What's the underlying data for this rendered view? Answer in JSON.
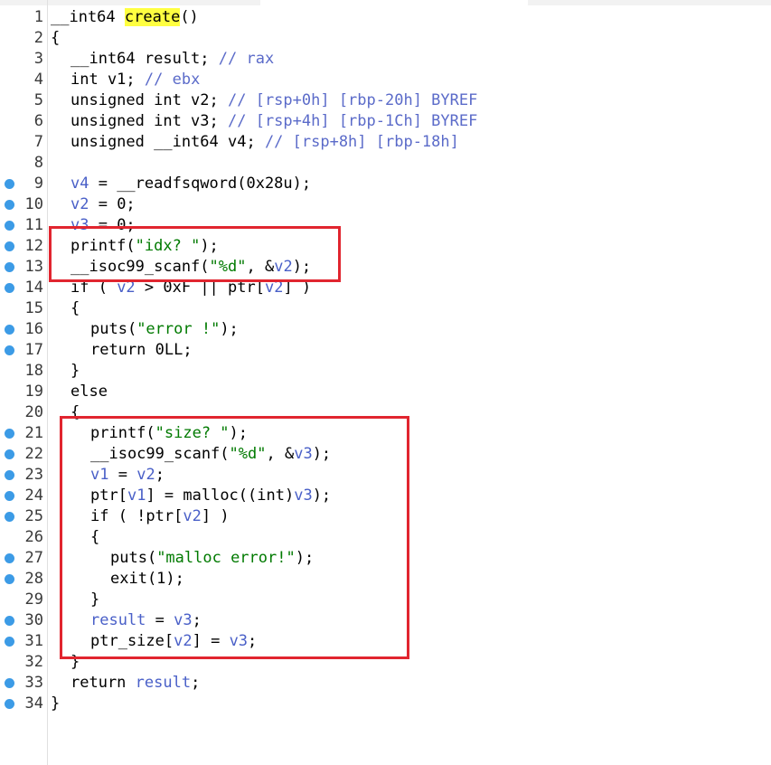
{
  "editor": {
    "lines": [
      {
        "no": "1",
        "bp": false,
        "indent": 0,
        "tokens": [
          [
            "t",
            "__int64 "
          ],
          [
            "h",
            "create"
          ],
          [
            "t",
            "()"
          ]
        ]
      },
      {
        "no": "2",
        "bp": false,
        "indent": 0,
        "tokens": [
          [
            "t",
            "{"
          ]
        ]
      },
      {
        "no": "3",
        "bp": false,
        "indent": 1,
        "tokens": [
          [
            "t",
            "__int64 result; "
          ],
          [
            "c",
            "// rax"
          ]
        ]
      },
      {
        "no": "4",
        "bp": false,
        "indent": 1,
        "tokens": [
          [
            "t",
            "int v1; "
          ],
          [
            "c",
            "// ebx"
          ]
        ]
      },
      {
        "no": "5",
        "bp": false,
        "indent": 1,
        "tokens": [
          [
            "t",
            "unsigned int v2; "
          ],
          [
            "c",
            "// [rsp+0h] [rbp-20h] BYREF"
          ]
        ]
      },
      {
        "no": "6",
        "bp": false,
        "indent": 1,
        "tokens": [
          [
            "t",
            "unsigned int v3; "
          ],
          [
            "c",
            "// [rsp+4h] [rbp-1Ch] BYREF"
          ]
        ]
      },
      {
        "no": "7",
        "bp": false,
        "indent": 1,
        "tokens": [
          [
            "t",
            "unsigned __int64 v4; "
          ],
          [
            "c",
            "// [rsp+8h] [rbp-18h]"
          ]
        ]
      },
      {
        "no": "8",
        "bp": false,
        "indent": 0,
        "tokens": []
      },
      {
        "no": "9",
        "bp": true,
        "indent": 1,
        "tokens": [
          [
            "v",
            "v4"
          ],
          [
            "t",
            " = __readfsqword(0x28u);"
          ]
        ]
      },
      {
        "no": "10",
        "bp": true,
        "indent": 1,
        "tokens": [
          [
            "v",
            "v2"
          ],
          [
            "t",
            " = 0;"
          ]
        ]
      },
      {
        "no": "11",
        "bp": true,
        "indent": 1,
        "tokens": [
          [
            "v",
            "v3"
          ],
          [
            "t",
            " = 0;"
          ]
        ]
      },
      {
        "no": "12",
        "bp": true,
        "indent": 1,
        "tokens": [
          [
            "t",
            "printf("
          ],
          [
            "s",
            "\"idx? \""
          ],
          [
            "t",
            ");"
          ]
        ]
      },
      {
        "no": "13",
        "bp": true,
        "indent": 1,
        "tokens": [
          [
            "t",
            "__isoc99_scanf("
          ],
          [
            "s",
            "\"%d\""
          ],
          [
            "t",
            ", &"
          ],
          [
            "v",
            "v2"
          ],
          [
            "t",
            ");"
          ]
        ]
      },
      {
        "no": "14",
        "bp": true,
        "indent": 1,
        "tokens": [
          [
            "t",
            "if ( "
          ],
          [
            "v",
            "v2"
          ],
          [
            "t",
            " > 0xF || ptr["
          ],
          [
            "v",
            "v2"
          ],
          [
            "t",
            "] )"
          ]
        ]
      },
      {
        "no": "15",
        "bp": false,
        "indent": 1,
        "tokens": [
          [
            "t",
            "{"
          ]
        ]
      },
      {
        "no": "16",
        "bp": true,
        "indent": 2,
        "tokens": [
          [
            "t",
            "puts("
          ],
          [
            "s",
            "\"error !\""
          ],
          [
            "t",
            ");"
          ]
        ]
      },
      {
        "no": "17",
        "bp": true,
        "indent": 2,
        "tokens": [
          [
            "t",
            "return 0LL;"
          ]
        ]
      },
      {
        "no": "18",
        "bp": false,
        "indent": 1,
        "tokens": [
          [
            "t",
            "}"
          ]
        ]
      },
      {
        "no": "19",
        "bp": false,
        "indent": 1,
        "tokens": [
          [
            "t",
            "else"
          ]
        ]
      },
      {
        "no": "20",
        "bp": false,
        "indent": 1,
        "tokens": [
          [
            "t",
            "{"
          ]
        ]
      },
      {
        "no": "21",
        "bp": true,
        "indent": 2,
        "tokens": [
          [
            "t",
            "printf("
          ],
          [
            "s",
            "\"size? \""
          ],
          [
            "t",
            ");"
          ]
        ]
      },
      {
        "no": "22",
        "bp": true,
        "indent": 2,
        "tokens": [
          [
            "t",
            "__isoc99_scanf("
          ],
          [
            "s",
            "\"%d\""
          ],
          [
            "t",
            ", &"
          ],
          [
            "v",
            "v3"
          ],
          [
            "t",
            ");"
          ]
        ]
      },
      {
        "no": "23",
        "bp": true,
        "indent": 2,
        "tokens": [
          [
            "v",
            "v1"
          ],
          [
            "t",
            " = "
          ],
          [
            "v",
            "v2"
          ],
          [
            "t",
            ";"
          ]
        ]
      },
      {
        "no": "24",
        "bp": true,
        "indent": 2,
        "tokens": [
          [
            "t",
            "ptr["
          ],
          [
            "v",
            "v1"
          ],
          [
            "t",
            "] = malloc((int)"
          ],
          [
            "v",
            "v3"
          ],
          [
            "t",
            ");"
          ]
        ]
      },
      {
        "no": "25",
        "bp": true,
        "indent": 2,
        "tokens": [
          [
            "t",
            "if ( !ptr["
          ],
          [
            "v",
            "v2"
          ],
          [
            "t",
            "] )"
          ]
        ]
      },
      {
        "no": "26",
        "bp": false,
        "indent": 2,
        "tokens": [
          [
            "t",
            "{"
          ]
        ]
      },
      {
        "no": "27",
        "bp": true,
        "indent": 3,
        "tokens": [
          [
            "t",
            "puts("
          ],
          [
            "s",
            "\"malloc error!\""
          ],
          [
            "t",
            ");"
          ]
        ]
      },
      {
        "no": "28",
        "bp": true,
        "indent": 3,
        "tokens": [
          [
            "t",
            "exit(1);"
          ]
        ]
      },
      {
        "no": "29",
        "bp": false,
        "indent": 2,
        "tokens": [
          [
            "t",
            "}"
          ]
        ]
      },
      {
        "no": "30",
        "bp": true,
        "indent": 2,
        "tokens": [
          [
            "v",
            "result"
          ],
          [
            "t",
            " = "
          ],
          [
            "v",
            "v3"
          ],
          [
            "t",
            ";"
          ]
        ]
      },
      {
        "no": "31",
        "bp": true,
        "indent": 2,
        "tokens": [
          [
            "t",
            "ptr_size["
          ],
          [
            "v",
            "v2"
          ],
          [
            "t",
            "] = "
          ],
          [
            "v",
            "v3"
          ],
          [
            "t",
            ";"
          ]
        ]
      },
      {
        "no": "32",
        "bp": false,
        "indent": 1,
        "tokens": [
          [
            "t",
            "}"
          ]
        ]
      },
      {
        "no": "33",
        "bp": true,
        "indent": 1,
        "tokens": [
          [
            "t",
            "return "
          ],
          [
            "v",
            "result"
          ],
          [
            "t",
            ";"
          ]
        ]
      },
      {
        "no": "34",
        "bp": true,
        "indent": 0,
        "tokens": [
          [
            "t",
            "}"
          ]
        ]
      }
    ]
  },
  "colors": {
    "keyword_text": "#000000",
    "variable": "#4a60c8",
    "comment": "#5b6bc9",
    "string": "#007a00",
    "highlight": "#ffff40",
    "annotation_box": "#e1252f",
    "breakpoint_dot": "#3c9be6"
  }
}
